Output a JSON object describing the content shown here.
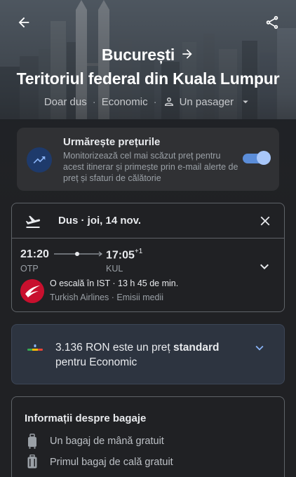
{
  "header": {
    "origin": "București",
    "destination": "Teritoriul federal din Kuala Lumpur",
    "trip_type": "Doar dus",
    "cabin_class": "Economic",
    "passengers": "Un pasager"
  },
  "track_prices": {
    "title": "Urmărește prețurile",
    "description": "Monitorizează cel mai scăzut preț pentru acest itinerar și primește prin e-mail alerte de preț și sfaturi de călătorie",
    "enabled": true
  },
  "flight": {
    "header": "Dus · joi, 14 nov.",
    "departure_time": "21:20",
    "arrival_time": "17:05",
    "arrival_day_offset": "+1",
    "departure_code": "OTP",
    "arrival_code": "KUL",
    "stops_duration": "O escală în IST · 13 h 45 de min.",
    "airline_emissions": "Turkish Airlines · Emisii medii"
  },
  "price_insight": {
    "text_before": "3.136 RON este un preț ",
    "text_bold": "standard",
    "text_after": " pentru Economic"
  },
  "baggage": {
    "title": "Informații despre bagaje",
    "items": [
      "Un bagaj de mână gratuit",
      "Primul bagaj de cală gratuit"
    ]
  },
  "colors": {
    "accent": "#8ab4f8",
    "toggle_track": "#5b8dd9",
    "airline_red": "#c8102e",
    "background": "#202124"
  },
  "icons": {
    "back": "arrow-back-icon",
    "share": "share-icon",
    "route_arrow": "arrow-right-icon",
    "passenger": "person-icon",
    "dropdown": "caret-down-icon",
    "trend": "trending-up-icon",
    "takeoff": "flight-takeoff-icon",
    "close": "close-icon",
    "expand": "chevron-down-icon",
    "price_bar": "price-level-icon",
    "carry_on": "carry-on-bag-icon",
    "checked_bag": "checked-bag-icon"
  }
}
